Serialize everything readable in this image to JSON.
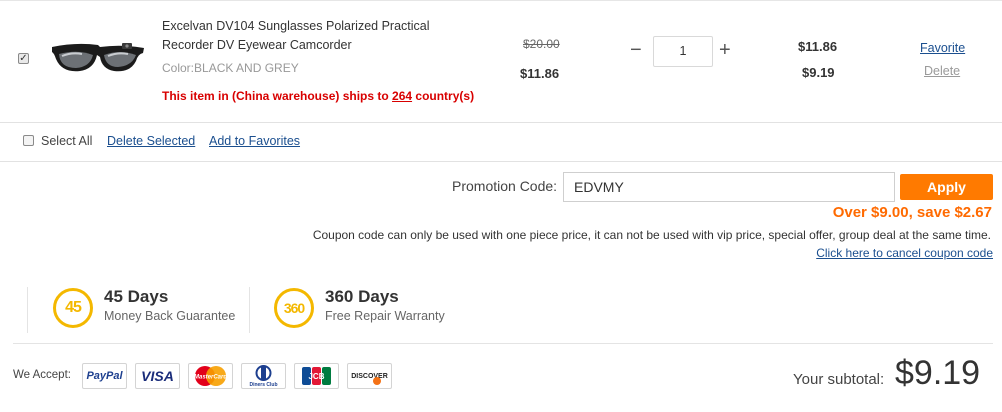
{
  "cart_item": {
    "checked": true,
    "title": "Excelvan DV104 Sunglasses Polarized Practical Recorder DV Eyewear Camcorder",
    "color": "Color:BLACK AND GREY",
    "ship_prefix": "This item in (China warehouse) ships to ",
    "ship_count": "264",
    "ship_suffix": " country(s)",
    "old_price": "$20.00",
    "unit_price": "$11.86",
    "qty_minus": "−",
    "qty_value": "1",
    "qty_plus": "+",
    "line_price": "$11.86",
    "line_price_discounted": "$9.19",
    "favorite_label": "Favorite",
    "delete_label": "Delete"
  },
  "bulk_actions": {
    "select_all": "Select All",
    "delete_selected": "Delete Selected",
    "add_to_favorites": "Add to Favorites"
  },
  "promotion": {
    "label": "Promotion Code:",
    "code_value": "EDVMY",
    "apply_label": "Apply",
    "savings_text": "Over $9.00, save $2.67",
    "note": "Coupon code can only be used with one piece price, it can not be used with vip price, special offer, group deal at the same time.",
    "cancel_link": "Click here to cancel coupon code"
  },
  "guarantees": [
    {
      "badge": "45",
      "title": "45 Days",
      "subtitle": "Money Back Guarantee"
    },
    {
      "badge": "360",
      "title": "360 Days",
      "subtitle": "Free Repair Warranty"
    }
  ],
  "payment": {
    "label": "We Accept:",
    "methods": [
      "PayPal",
      "VISA",
      "MasterCard",
      "Diners Club",
      "JCB",
      "DISCOVER"
    ]
  },
  "subtotal": {
    "label": "Your subtotal:",
    "value": "$9.19"
  },
  "colors": {
    "accent": "#ff7a00",
    "savings": "#ff6a00",
    "warning": "#d80000",
    "link": "#1b4f8f",
    "badge": "#f4b800"
  }
}
